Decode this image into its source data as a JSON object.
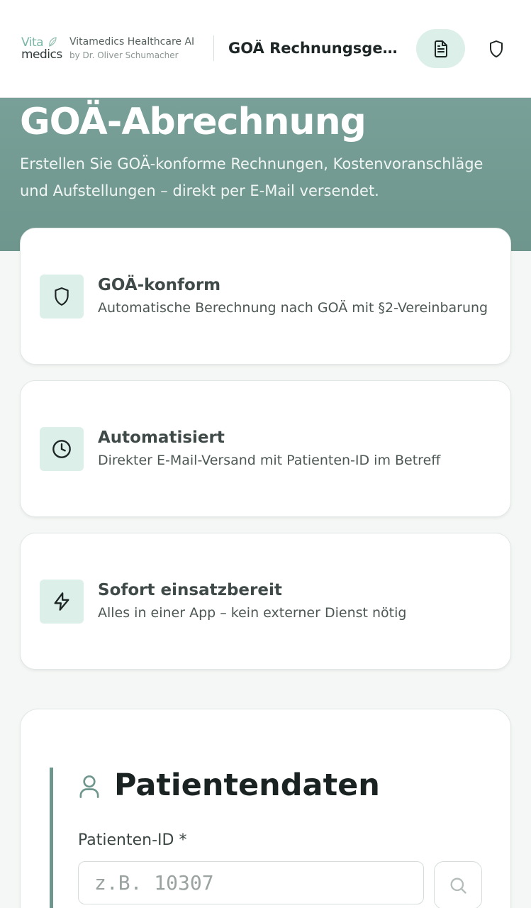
{
  "header": {
    "logo_top": "Vita",
    "logo_bottom": "medics",
    "brand_name": "Vitamedics Healthcare AI",
    "brand_sub": "by Dr. Oliver Schumacher",
    "title": "GOÄ Rechnungsgenerator",
    "icons": [
      "document-icon",
      "shield-icon"
    ]
  },
  "hero": {
    "title": "GOÄ-Abrechnung",
    "description": "Erstellen Sie GOÄ-konforme Rechnungen, Kostenvoranschläge und Aufstellungen – direkt per E-Mail versendet."
  },
  "features": [
    {
      "icon": "shield-icon",
      "title": "GOÄ-konform",
      "description": "Automatische Berechnung nach GOÄ mit §2-Vereinbarung"
    },
    {
      "icon": "clock-icon",
      "title": "Automatisiert",
      "description": "Direkter E-Mail-Versand mit Patienten-ID im Betreff"
    },
    {
      "icon": "lightning-icon",
      "title": "Sofort einsatzbereit",
      "description": "Alles in einer App – kein externer Dienst nötig"
    }
  ],
  "form": {
    "section_title": "Patientendaten",
    "patient_id_label": "Patienten-ID *",
    "patient_id_placeholder": "z.B. 10307",
    "patient_id_value": ""
  },
  "colors": {
    "accent": "#6e968d",
    "accent_light": "#dcefe9",
    "hero_bg": "#78a098"
  }
}
